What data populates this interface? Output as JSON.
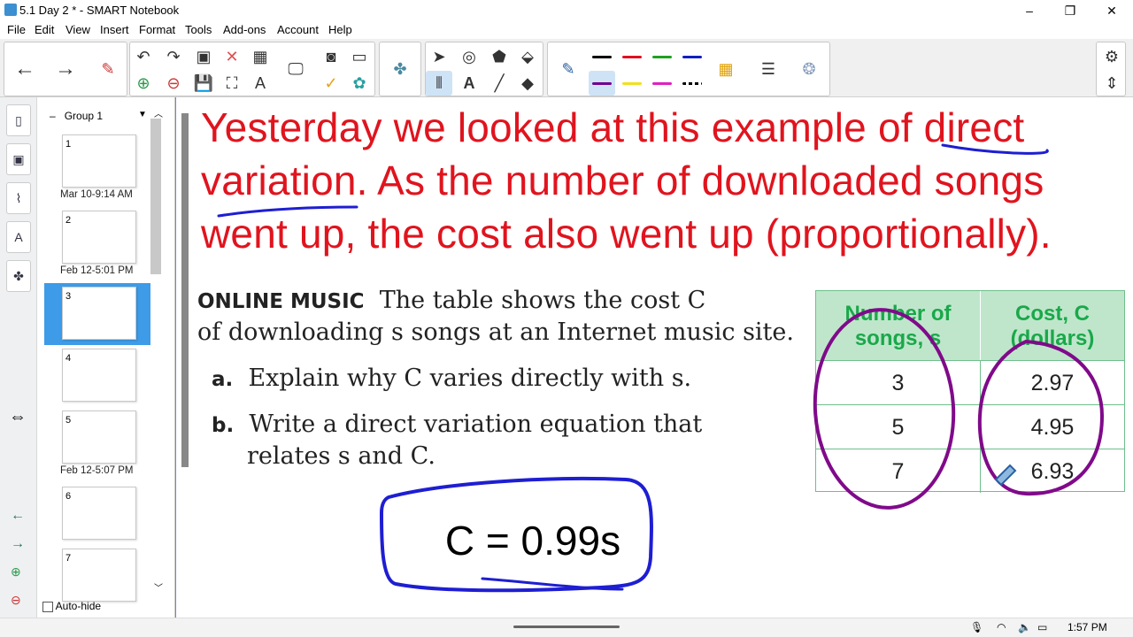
{
  "window": {
    "title": "5.1 Day 2 * - SMART Notebook",
    "minimize": "–",
    "maximize": "❐",
    "close": "✕"
  },
  "menu": [
    "File",
    "Edit",
    "View",
    "Insert",
    "Format",
    "Tools",
    "Add-ons",
    "Account",
    "Help"
  ],
  "sidebar": {
    "group_label": "Group 1",
    "autohide_label": "Auto-hide",
    "thumbnails": [
      {
        "num": "1",
        "caption": "Mar 10-9:14 AM"
      },
      {
        "num": "2",
        "caption": "Feb 12-5:01 PM"
      },
      {
        "num": "3",
        "caption": ""
      },
      {
        "num": "4",
        "caption": ""
      },
      {
        "num": "5",
        "caption": "Feb 12-5:07 PM"
      },
      {
        "num": "6",
        "caption": ""
      },
      {
        "num": "7",
        "caption": ""
      }
    ]
  },
  "page": {
    "red_note": "Yesterday we looked at this example of direct variation. As the number of downloaded songs went up, the cost also went up (proportionally).",
    "problem_heading": "ONLINE MUSIC",
    "problem_line1": "The table shows the cost C",
    "problem_line2": "of downloading s songs at an Internet music site.",
    "part_a_label": "a.",
    "part_a_text": "Explain why C varies directly with s.",
    "part_b_label": "b.",
    "part_b_line1": "Write a direct variation equation that",
    "part_b_line2": "relates s and C.",
    "table": {
      "headers": [
        "Number of songs, s",
        "Cost, C (dollars)"
      ],
      "rows": [
        [
          "3",
          "2.97"
        ],
        [
          "5",
          "4.95"
        ],
        [
          "7",
          "6.93"
        ]
      ]
    },
    "equation": "C = 0.99s"
  },
  "colors": {
    "red_ink": "#e0141e",
    "blue_ink": "#1e1ed2",
    "purple_ink": "#800a8a",
    "table_header_bg": "#bfe6cb",
    "table_header_text": "#1aa84a"
  },
  "status": {
    "time": "1:57 PM"
  }
}
